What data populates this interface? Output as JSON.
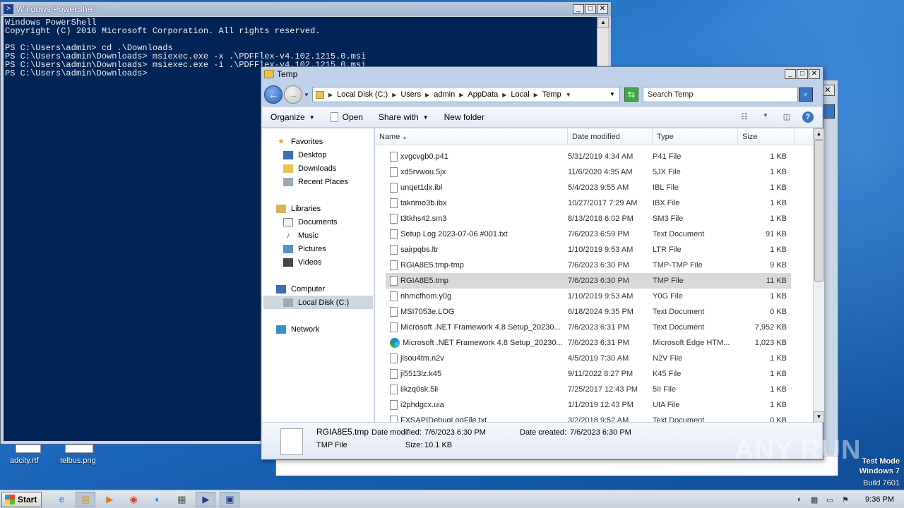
{
  "powershell": {
    "title": "Windows PowerShell",
    "lines": [
      "Windows PowerShell",
      "Copyright (C) 2016 Microsoft Corporation. All rights reserved.",
      "",
      "PS C:\\Users\\admin> cd .\\Downloads",
      "PS C:\\Users\\admin\\Downloads> msiexec.exe -x .\\PDFFlex-v4.102.1215.0.msi",
      "PS C:\\Users\\admin\\Downloads> msiexec.exe -i .\\PDFFlex-v4.102.1215.0.msi",
      "PS C:\\Users\\admin\\Downloads>"
    ]
  },
  "explorer": {
    "title": "Temp",
    "breadcrumbs": [
      "Local Disk (C:)",
      "Users",
      "admin",
      "AppData",
      "Local",
      "Temp"
    ],
    "search_placeholder": "Search Temp",
    "toolbar": {
      "organize": "Organize",
      "open": "Open",
      "share_with": "Share with",
      "new_folder": "New folder"
    },
    "nav": {
      "favorites": "Favorites",
      "desktop": "Desktop",
      "downloads": "Downloads",
      "recent": "Recent Places",
      "libraries": "Libraries",
      "documents": "Documents",
      "music": "Music",
      "pictures": "Pictures",
      "videos": "Videos",
      "computer": "Computer",
      "local_disk": "Local Disk (C:)",
      "network": "Network"
    },
    "columns": {
      "name": "Name",
      "date": "Date modified",
      "type": "Type",
      "size": "Size"
    },
    "files": [
      {
        "name": "xvgcvgb0.p41",
        "date": "5/31/2019 4:34 AM",
        "type": "P41 File",
        "size": "1 KB"
      },
      {
        "name": "xd5rvwou.5jx",
        "date": "11/6/2020 4:35 AM",
        "type": "5JX File",
        "size": "1 KB"
      },
      {
        "name": "unqet1dx.ibl",
        "date": "5/4/2023 9:55 AM",
        "type": "IBL File",
        "size": "1 KB"
      },
      {
        "name": "taknmo3b.ibx",
        "date": "10/27/2017 7:29 AM",
        "type": "IBX File",
        "size": "1 KB"
      },
      {
        "name": "t3tkhs42.sm3",
        "date": "8/13/2018 6:02 PM",
        "type": "SM3 File",
        "size": "1 KB"
      },
      {
        "name": "Setup Log 2023-07-06 #001.txt",
        "date": "7/6/2023 6:59 PM",
        "type": "Text Document",
        "size": "91 KB"
      },
      {
        "name": "sairpqbs.ltr",
        "date": "1/10/2019 9:53 AM",
        "type": "LTR File",
        "size": "1 KB"
      },
      {
        "name": "RGIA8E5.tmp-tmp",
        "date": "7/6/2023 6:30 PM",
        "type": "TMP-TMP File",
        "size": "9 KB"
      },
      {
        "name": "RGIA8E5.tmp",
        "date": "7/6/2023 6:30 PM",
        "type": "TMP File",
        "size": "11 KB"
      },
      {
        "name": "nhmcfhom.y0g",
        "date": "1/10/2019 9:53 AM",
        "type": "Y0G File",
        "size": "1 KB"
      },
      {
        "name": "MSI7053e.LOG",
        "date": "6/18/2024 9:35 PM",
        "type": "Text Document",
        "size": "0 KB"
      },
      {
        "name": "Microsoft .NET Framework 4.8 Setup_20230...",
        "date": "7/6/2023 6:31 PM",
        "type": "Text Document",
        "size": "7,952 KB"
      },
      {
        "name": "Microsoft .NET Framework 4.8 Setup_20230...",
        "date": "7/6/2023 6:31 PM",
        "type": "Microsoft Edge HTM...",
        "size": "1,023 KB"
      },
      {
        "name": "jisou4tm.n2v",
        "date": "4/5/2019 7:30 AM",
        "type": "N2V File",
        "size": "1 KB"
      },
      {
        "name": "ji5513lz.k45",
        "date": "9/11/2022 8:27 PM",
        "type": "K45 File",
        "size": "1 KB"
      },
      {
        "name": "iikzq0sk.5ii",
        "date": "7/25/2017 12:43 PM",
        "type": "5II File",
        "size": "1 KB"
      },
      {
        "name": "i2phdgcx.uia",
        "date": "1/1/2019 12:43 PM",
        "type": "UIA File",
        "size": "1 KB"
      },
      {
        "name": "FXSAPIDebugLogFile.txt",
        "date": "3/2/2018 9:52 AM",
        "type": "Text Document",
        "size": "0 KB"
      }
    ],
    "selected_index": 8,
    "details": {
      "name": "RGIA8E5.tmp",
      "modified_label": "Date modified:",
      "modified": "7/6/2023 6:30 PM",
      "created_label": "Date created:",
      "created": "7/6/2023 6:30 PM",
      "type": "TMP File",
      "size_label": "Size:",
      "size": "10.1 KB"
    }
  },
  "desktop": {
    "icon1": "adcity.rtf",
    "icon2": "telbus.png"
  },
  "watermark": "ANY RUN",
  "os_info": {
    "line1": "Test Mode",
    "line2": "Windows 7",
    "line3": "Build 7601"
  },
  "taskbar": {
    "start": "Start",
    "clock": "9:36 PM"
  }
}
